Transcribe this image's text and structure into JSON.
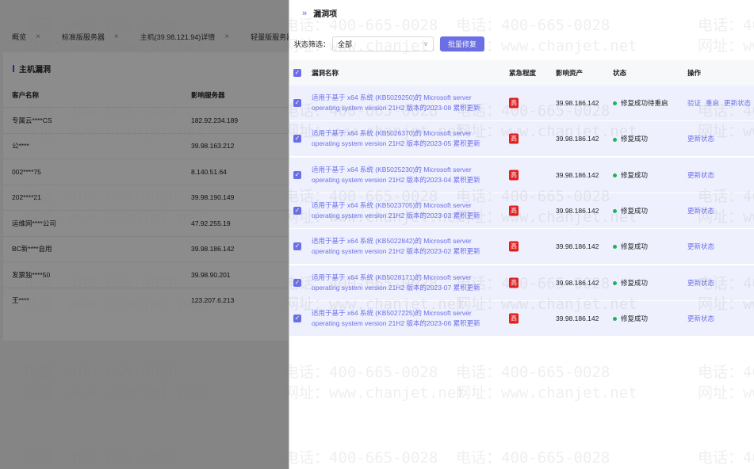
{
  "tabs": [
    {
      "label": "概览"
    },
    {
      "label": "标准版服务器"
    },
    {
      "label": "主机(39.98.121.94)详情"
    },
    {
      "label": "轻量版服务器"
    }
  ],
  "left": {
    "title": "主机漏洞",
    "headers": [
      "客户名称",
      "影响服务器"
    ],
    "rows": [
      [
        "专属云****CS",
        "182.92.234.189"
      ],
      [
        "公****",
        "39.98.163.212"
      ],
      [
        "002****75",
        "8.140.51.64"
      ],
      [
        "202****21",
        "39.98.190.149"
      ],
      [
        "运维网****公司",
        "47.92.255.19"
      ],
      [
        "BC新****自用",
        "39.98.186.142"
      ],
      [
        "发票独****50",
        "39.98.90.201"
      ],
      [
        "王****",
        "123.207.6.213"
      ]
    ]
  },
  "drawer": {
    "title": "漏洞项",
    "filter_label": "状态筛选：",
    "filter_value": "全部",
    "batch_button": "批量修复",
    "headers": [
      "漏洞名称",
      "紧急程度",
      "影响资产",
      "状态",
      "操作"
    ],
    "rows": [
      {
        "name1": "适用于基于 x64 系统 (KB5029250)的 Microsoft server",
        "name2": "operating system version 21H2 版本的2023-08 累积更新",
        "level": "高",
        "asset": "39.98.186.142",
        "status": "修复成功待重启",
        "ops": [
          "验证",
          "重启",
          "更新状态"
        ]
      },
      {
        "name1": "适用于基于 x64 系统 (KB5026370)的 Microsoft server",
        "name2": "operating system version 21H2 版本的2023-05 累积更新",
        "level": "高",
        "asset": "39.98.186.142",
        "status": "修复成功",
        "ops": [
          "更新状态"
        ]
      },
      {
        "name1": "适用于基于 x64 系统 (KB5025230)的 Microsoft server",
        "name2": "operating system version 21H2 版本的2023-04 累积更新",
        "level": "高",
        "asset": "39.98.186.142",
        "status": "修复成功",
        "ops": [
          "更新状态"
        ]
      },
      {
        "name1": "适用于基于 x64 系统 (KB5023705)的 Microsoft server",
        "name2": "operating system version 21H2 版本的2023-03 累积更新",
        "level": "高",
        "asset": "39.98.186.142",
        "status": "修复成功",
        "ops": [
          "更新状态"
        ]
      },
      {
        "name1": "适用于基于 x64 系统 (KB5022842)的 Microsoft server",
        "name2": "operating system version 21H2 版本的2023-02 累积更新",
        "level": "高",
        "asset": "39.98.186.142",
        "status": "修复成功",
        "ops": [
          "更新状态"
        ]
      },
      {
        "name1": "适用于基于 x64 系统 (KB5028171)的 Microsoft server",
        "name2": "operating system version 21H2 版本的2023-07 累积更新",
        "level": "高",
        "asset": "39.98.186.142",
        "status": "修复成功",
        "ops": [
          "更新状态"
        ]
      },
      {
        "name1": "适用于基于 x64 系统 (KB5027225)的 Microsoft server",
        "name2": "operating system version 21H2 版本的2023-06 累积更新",
        "level": "高",
        "asset": "39.98.186.142",
        "status": "修复成功",
        "ops": [
          "更新状态"
        ]
      }
    ]
  },
  "watermark": {
    "phone": "电话：400-665-0028",
    "site": "网址：www.chanjet.net"
  }
}
